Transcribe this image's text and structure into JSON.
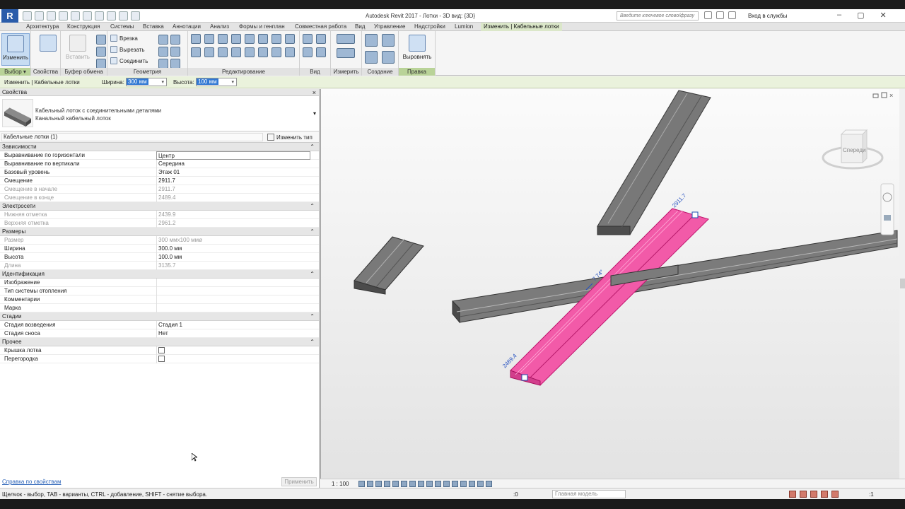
{
  "app": {
    "logo": "R",
    "title": "Autodesk Revit 2017 -     Лотки - 3D вид: {3D}"
  },
  "titlebar": {
    "search_placeholder": "Введите ключевое слово/фразу",
    "signin": "Вход в службы",
    "help": "?",
    "window_controls": [
      "–",
      "▢",
      "✕"
    ]
  },
  "tabs": [
    "Архитектура",
    "Конструкция",
    "Системы",
    "Вставка",
    "Аннотации",
    "Анализ",
    "Формы и генплан",
    "Совместная работа",
    "Вид",
    "Управление",
    "Надстройки",
    "Lumion",
    "Изменить | Кабельные лотки"
  ],
  "ribbon": {
    "select": {
      "button": "Изменить",
      "label": "Выбор ▾"
    },
    "properties": {
      "label": "Свойства"
    },
    "clipboard": {
      "paste": "Вставить",
      "label": "Буфер обмена"
    },
    "geometry": {
      "cut": "Врезка",
      "unjoin": "Вырезать",
      "join": "Соединить",
      "label": "Геометрия"
    },
    "modify": {
      "label": "Редактирование"
    },
    "view": {
      "label": "Вид"
    },
    "measure": {
      "label": "Измерить"
    },
    "create": {
      "label": "Создание"
    },
    "edit": {
      "button": "Выровнять",
      "label": "Правка"
    }
  },
  "options": {
    "context": "Изменить | Кабельные лотки",
    "width_label": "Ширина:",
    "width_value": "300 мм",
    "height_label": "Высота:",
    "height_value": "100 мм"
  },
  "properties": {
    "title": "Свойства",
    "type_family": "Кабельный лоток с соединительными деталями",
    "type_name": "Канальный кабельный лоток",
    "instance_filter": "Кабельные лотки (1)",
    "edit_type": "Изменить тип",
    "sections": [
      {
        "name": "Зависимости",
        "rows": [
          {
            "k": "Выравнивание по горизонтали",
            "v": "Центр",
            "edit": true
          },
          {
            "k": "Выравнивание по вертикали",
            "v": "Середина"
          },
          {
            "k": "Базовый уровень",
            "v": "Этаж 01"
          },
          {
            "k": "Смещение",
            "v": "2911.7"
          },
          {
            "k": "Смещение в начале",
            "v": "2911.7",
            "ro": true
          },
          {
            "k": "Смещение в конце",
            "v": "2489.4",
            "ro": true
          }
        ]
      },
      {
        "name": "Электросети",
        "rows": [
          {
            "k": "Нижняя отметка",
            "v": "2439.9",
            "ro": true
          },
          {
            "k": "Верхняя отметка",
            "v": "2961.2",
            "ro": true
          }
        ]
      },
      {
        "name": "Размеры",
        "rows": [
          {
            "k": "Размер",
            "v": "300 ммx100 ммø",
            "ro": true
          },
          {
            "k": "Ширина",
            "v": "300.0 мм"
          },
          {
            "k": "Высота",
            "v": "100.0 мм"
          },
          {
            "k": "Длина",
            "v": "3135.7",
            "ro": true
          }
        ]
      },
      {
        "name": "Идентификация",
        "rows": [
          {
            "k": "Изображение",
            "v": ""
          },
          {
            "k": "Тип системы отопления",
            "v": ""
          },
          {
            "k": "Комментарии",
            "v": ""
          },
          {
            "k": "Марка",
            "v": ""
          }
        ]
      },
      {
        "name": "Стадии",
        "rows": [
          {
            "k": "Стадия возведения",
            "v": "Стадия 1"
          },
          {
            "k": "Стадия сноса",
            "v": "Нет"
          }
        ]
      },
      {
        "name": "Прочее",
        "rows": [
          {
            "k": "Крышка лотка",
            "v": "",
            "checkbox": true
          },
          {
            "k": "Перегородка",
            "v": "",
            "checkbox": true
          }
        ]
      }
    ],
    "help_link": "Справка по свойствам",
    "apply": "Применить"
  },
  "viewport": {
    "viewcube_label": "Спереди",
    "dim_top": "2911.7",
    "dim_bottom": "2489.4",
    "slope": "7.74°",
    "colors": {
      "selected": "#f25aa8",
      "tray": "#6e6e6e"
    }
  },
  "viewbar": {
    "scale": "1 : 100"
  },
  "status": {
    "text": "Щелчок - выбор, TAB - варианты, CTRL - добавление, SHIFT - снятие выбора.",
    "num": ":0",
    "model": "Главная модель",
    "filter": ":1"
  }
}
